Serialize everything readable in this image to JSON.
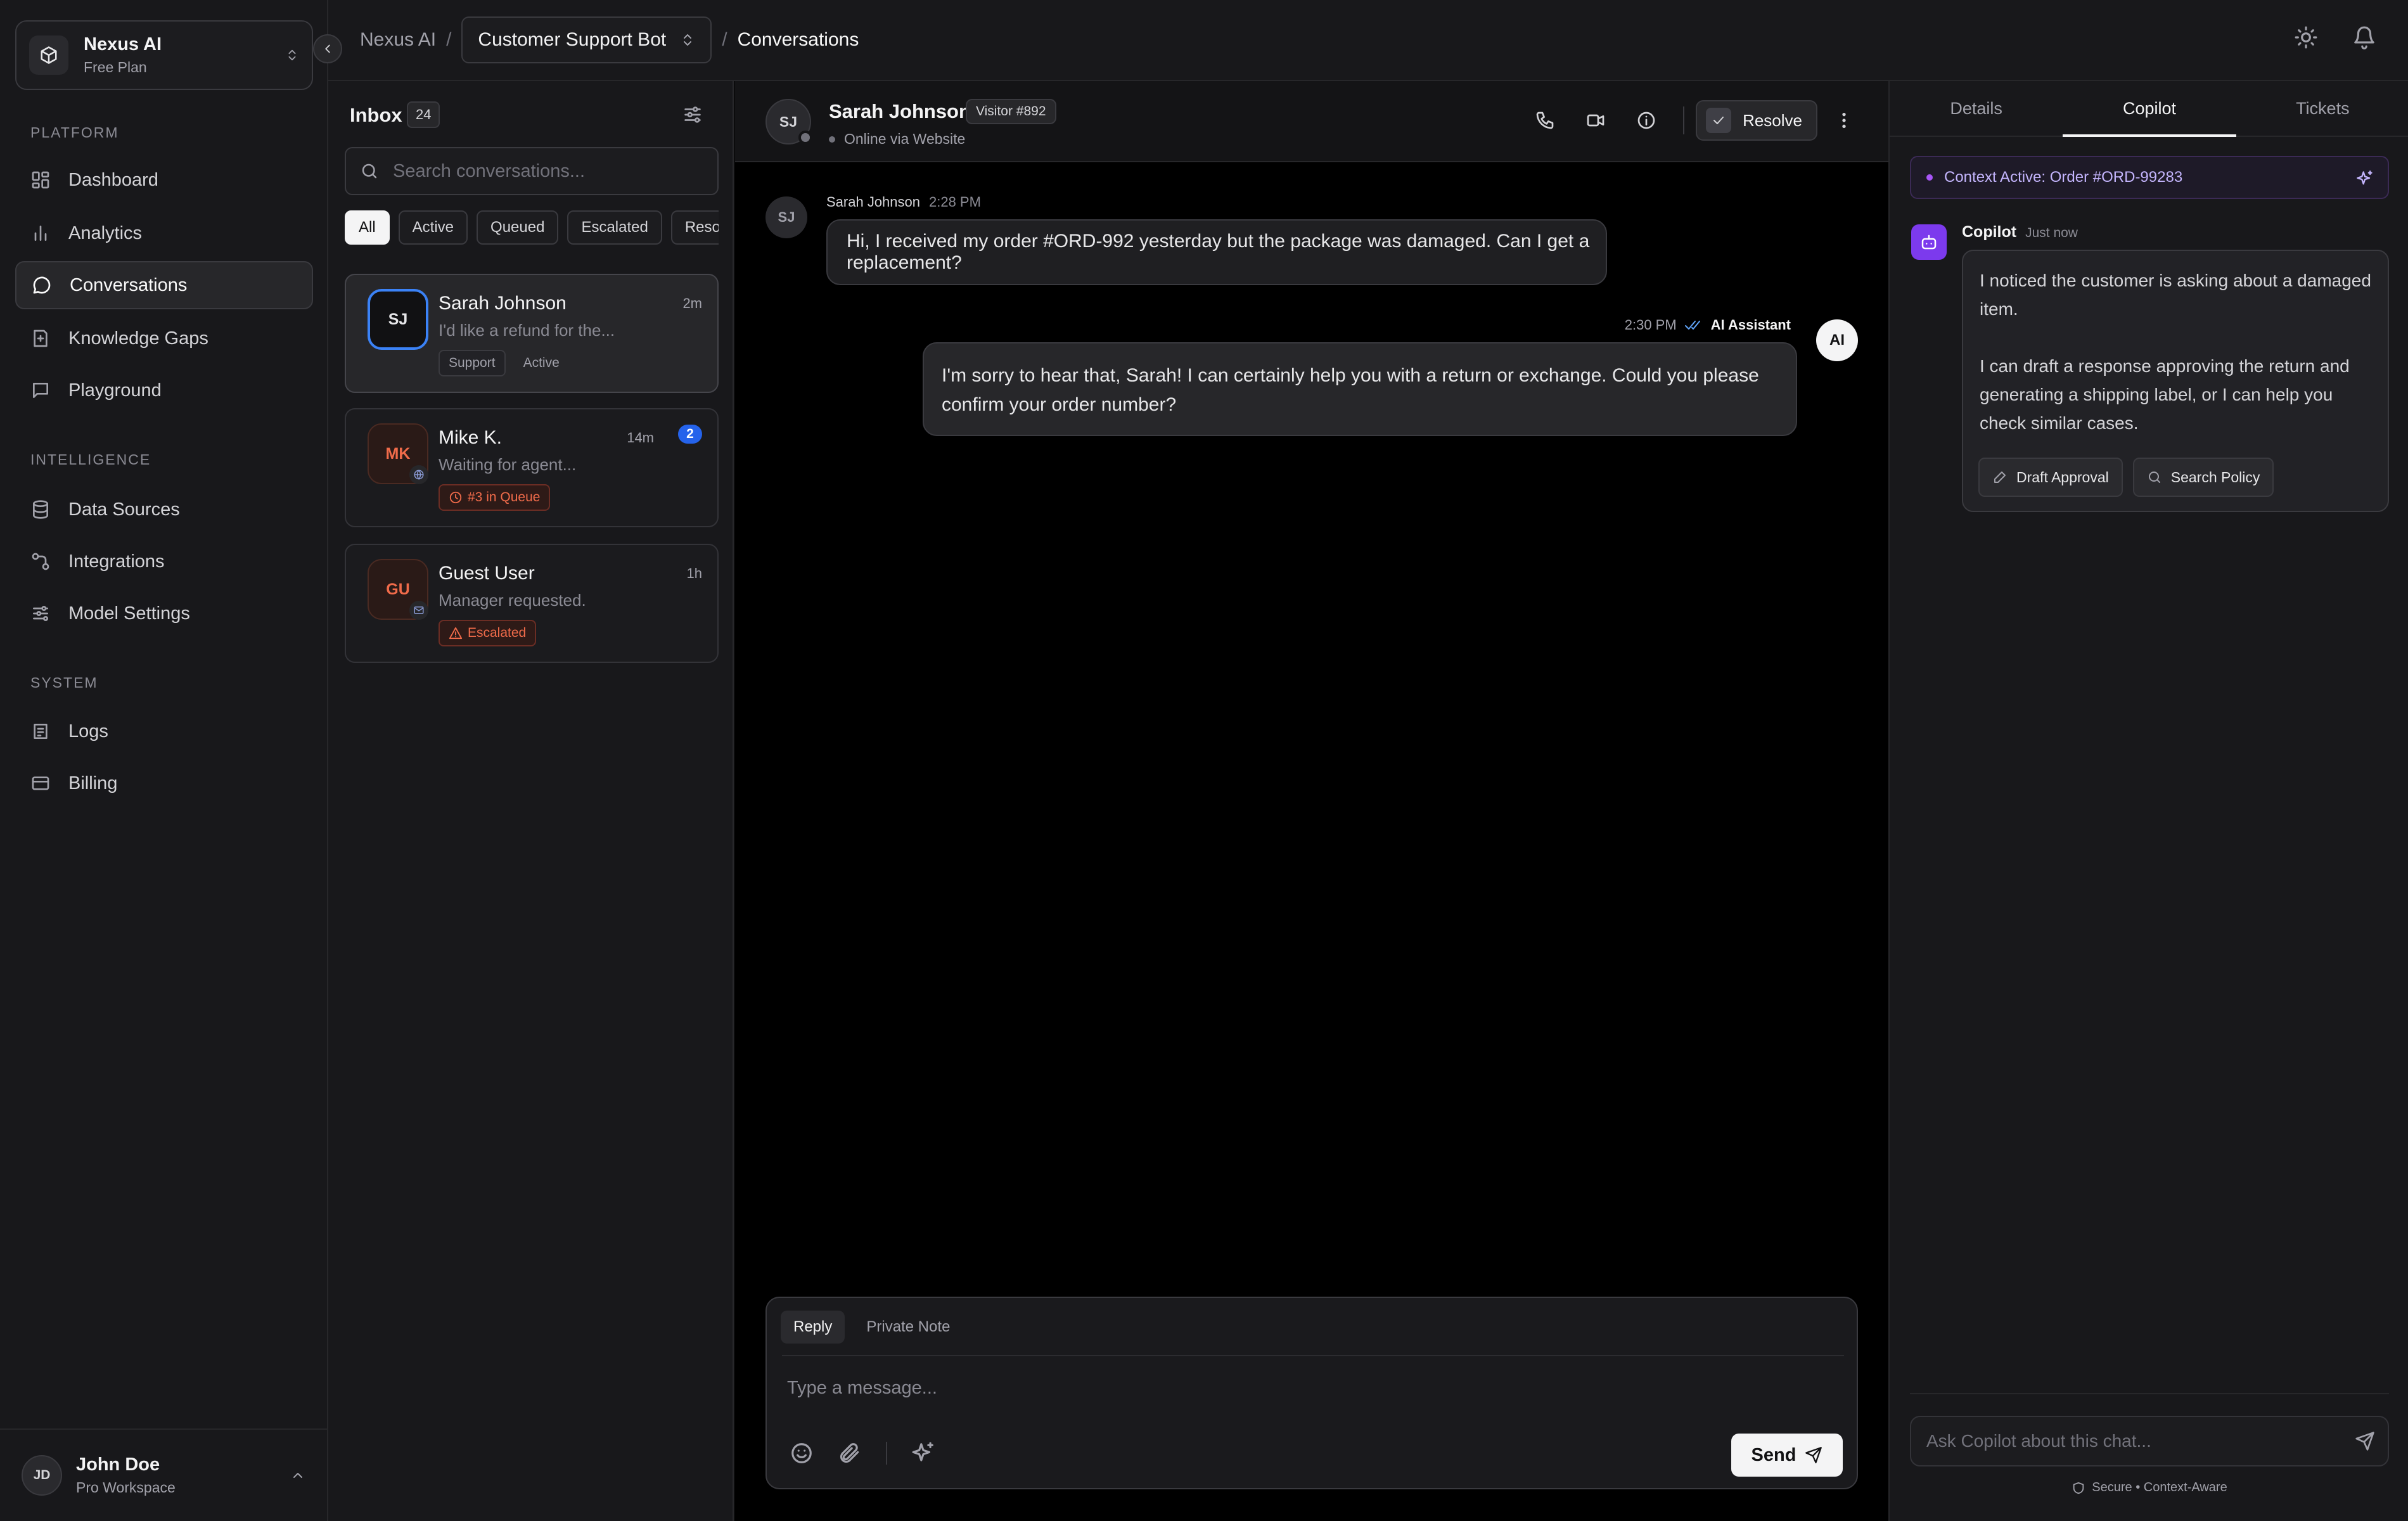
{
  "workspace": {
    "name": "Nexus AI",
    "plan": "Free Plan"
  },
  "nav": {
    "platform_title": "PLATFORM",
    "platform_items": [
      {
        "label": "Dashboard",
        "icon": "dashboard-icon"
      },
      {
        "label": "Analytics",
        "icon": "analytics-icon"
      },
      {
        "label": "Conversations",
        "icon": "chat-icon",
        "active": true
      },
      {
        "label": "Knowledge Gaps",
        "icon": "book-icon"
      },
      {
        "label": "Playground",
        "icon": "message-square-icon"
      }
    ],
    "intelligence_title": "INTELLIGENCE",
    "intelligence_items": [
      {
        "label": "Data Sources",
        "icon": "database-icon"
      },
      {
        "label": "Integrations",
        "icon": "integration-icon"
      },
      {
        "label": "Model Settings",
        "icon": "sliders-icon"
      }
    ],
    "system_title": "SYSTEM",
    "system_items": [
      {
        "label": "Logs",
        "icon": "logs-icon"
      },
      {
        "label": "Billing",
        "icon": "credit-card-icon"
      }
    ]
  },
  "user": {
    "initials": "JD",
    "name": "John Doe",
    "workspace": "Pro Workspace"
  },
  "breadcrumb": {
    "root": "Nexus AI",
    "sep": "/",
    "bot": "Customer Support Bot",
    "current": "Conversations"
  },
  "inbox": {
    "title": "Inbox",
    "count": "24",
    "search_placeholder": "Search conversations...",
    "filters": [
      "All",
      "Active",
      "Queued",
      "Escalated",
      "Resolved"
    ],
    "conversations": [
      {
        "initials": "SJ",
        "name": "Sarah Johnson",
        "time": "2m",
        "preview": "I'd like a refund for the...",
        "tags": [
          "Support",
          "Active"
        ]
      },
      {
        "initials": "MK",
        "name": "Mike K.",
        "time": "14m",
        "preview": "Waiting for agent...",
        "tag": "#3 in Queue",
        "unread": "2"
      },
      {
        "initials": "GU",
        "name": "Guest User",
        "time": "1h",
        "preview": "Manager requested.",
        "tag": "Escalated"
      }
    ]
  },
  "chat": {
    "contact_initials": "SJ",
    "contact_name": "Sarah Johnson",
    "visitor_badge": "Visitor #892",
    "status": "Online via Website",
    "resolve_label": "Resolve",
    "messages": [
      {
        "sender": "Sarah Johnson",
        "time": "2:28 PM",
        "initials": "SJ",
        "text": "Hi, I received my order #ORD-992 yesterday but the package was damaged. Can I get a replacement?"
      },
      {
        "sender": "AI Assistant",
        "time": "2:30 PM",
        "initials": "AI",
        "text": "I'm sorry to hear that, Sarah! I can certainly help you with a return or exchange. Could you please confirm your order number?"
      }
    ],
    "composer": {
      "tab_reply": "Reply",
      "tab_note": "Private Note",
      "placeholder": "Type a message...",
      "send_label": "Send"
    }
  },
  "right_panel": {
    "tabs": [
      "Details",
      "Copilot",
      "Tickets"
    ],
    "active_tab": "Copilot",
    "context": "Context Active: Order #ORD-99283",
    "copilot_name": "Copilot",
    "copilot_time": "Just now",
    "copilot_p1": "I noticed the customer is asking about a damaged item.",
    "copilot_p2": "I can draft a response approving the return and generating a shipping label, or I can help you check similar cases.",
    "btn_draft": "Draft Approval",
    "btn_search": "Search Policy",
    "ask_placeholder": "Ask Copilot about this chat...",
    "footer": "Secure • Context-Aware"
  },
  "colors": {
    "accent_blue": "#3b82f6",
    "copilot_purple": "#7c3aed",
    "escalation_red": "#f06b4a",
    "unread_badge": "#2563eb"
  }
}
